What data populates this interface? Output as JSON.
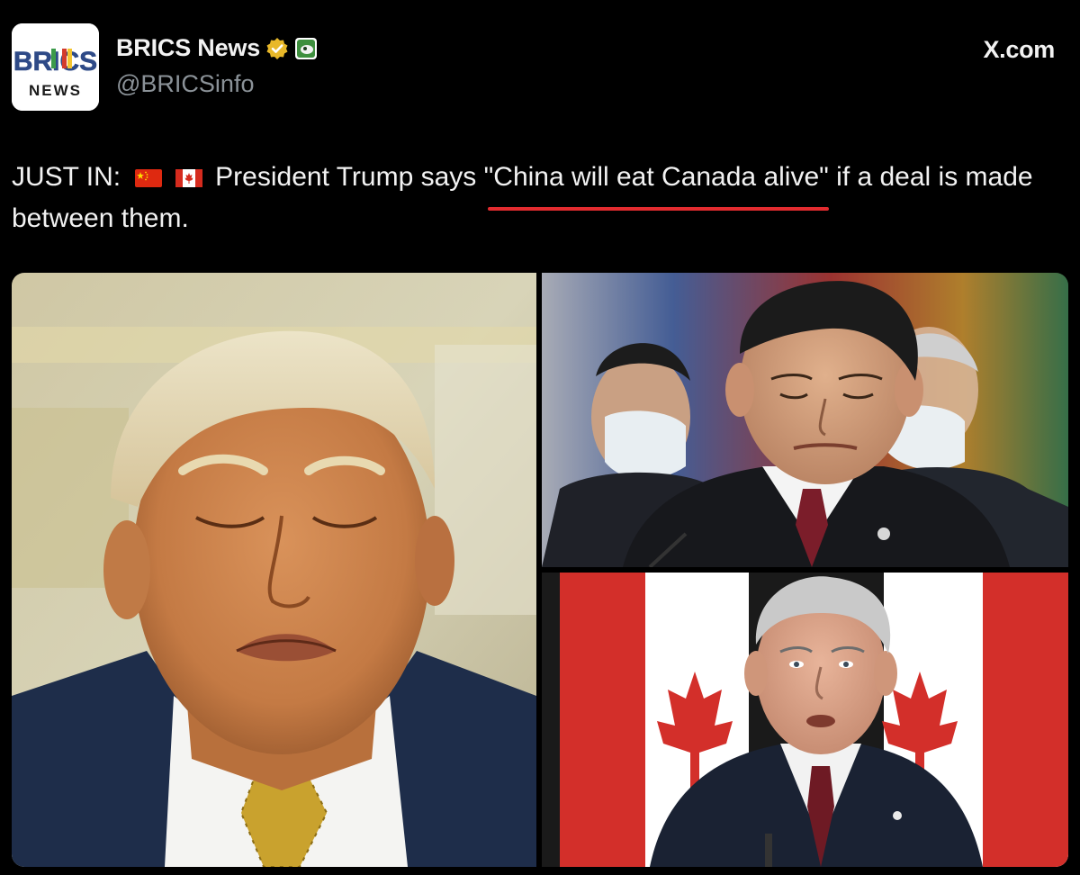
{
  "header": {
    "avatar_text_top": "BRICS",
    "avatar_text_bottom": "NEWS",
    "display_name": "BRICS News",
    "handle": "@BRICSinfo",
    "site": "X.com",
    "verified_icon": "gold-verified-badge-icon",
    "affiliate_icon": "affiliate-badge-icon"
  },
  "tweet": {
    "prefix": "JUST IN:",
    "flags": [
      "china-flag-icon",
      "canada-flag-icon"
    ],
    "before_quote": "President Trump says ",
    "quote": "\"China will eat Canada alive\"",
    "after_quote": " if a deal is made between them.",
    "underline_color": "#e22b2f"
  },
  "media": {
    "photos": [
      {
        "name": "photo-trump"
      },
      {
        "name": "photo-xi-jinping"
      },
      {
        "name": "photo-mark-carney"
      }
    ]
  }
}
